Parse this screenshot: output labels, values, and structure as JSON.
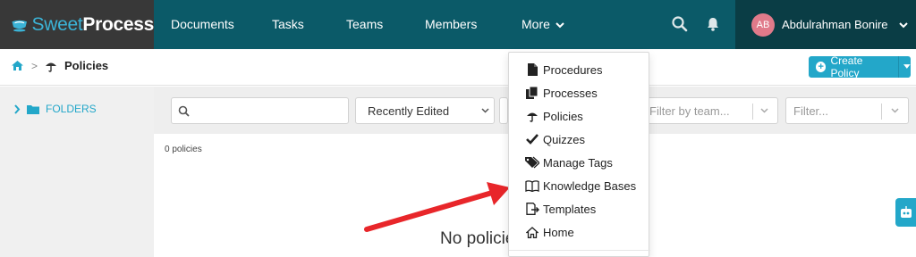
{
  "brand": {
    "part1": "Sweet",
    "part2": "Process"
  },
  "nav": {
    "documents": "Documents",
    "tasks": "Tasks",
    "teams": "Teams",
    "members": "Members",
    "more": "More"
  },
  "user": {
    "initials": "AB",
    "name": "Abdulrahman Bonire"
  },
  "breadcrumb": {
    "separator": ">",
    "title": "Policies"
  },
  "create_button": {
    "label": "Create Policy"
  },
  "sidebar": {
    "folders_label": "FOLDERS"
  },
  "filters": {
    "search_placeholder": "",
    "sort_value": "Recently Edited",
    "team_placeholder": "Filter by team...",
    "generic_placeholder": "Filter..."
  },
  "list": {
    "count": "0 policies",
    "empty_text": "No policie"
  },
  "more_menu": {
    "items": [
      {
        "label": "Procedures",
        "icon": "file-icon"
      },
      {
        "label": "Processes",
        "icon": "copy-icon"
      },
      {
        "label": "Policies",
        "icon": "umbrella-icon"
      },
      {
        "label": "Quizzes",
        "icon": "check-icon"
      },
      {
        "label": "Manage Tags",
        "icon": "tags-icon"
      },
      {
        "label": "Knowledge Bases",
        "icon": "book-icon"
      },
      {
        "label": "Templates",
        "icon": "template-icon"
      },
      {
        "label": "Home",
        "icon": "home-icon"
      }
    ]
  },
  "colors": {
    "topbar": "#0b5a68",
    "brand_bg": "#383838",
    "accent": "#23a7c9",
    "annotation_arrow": "#e8262a"
  }
}
